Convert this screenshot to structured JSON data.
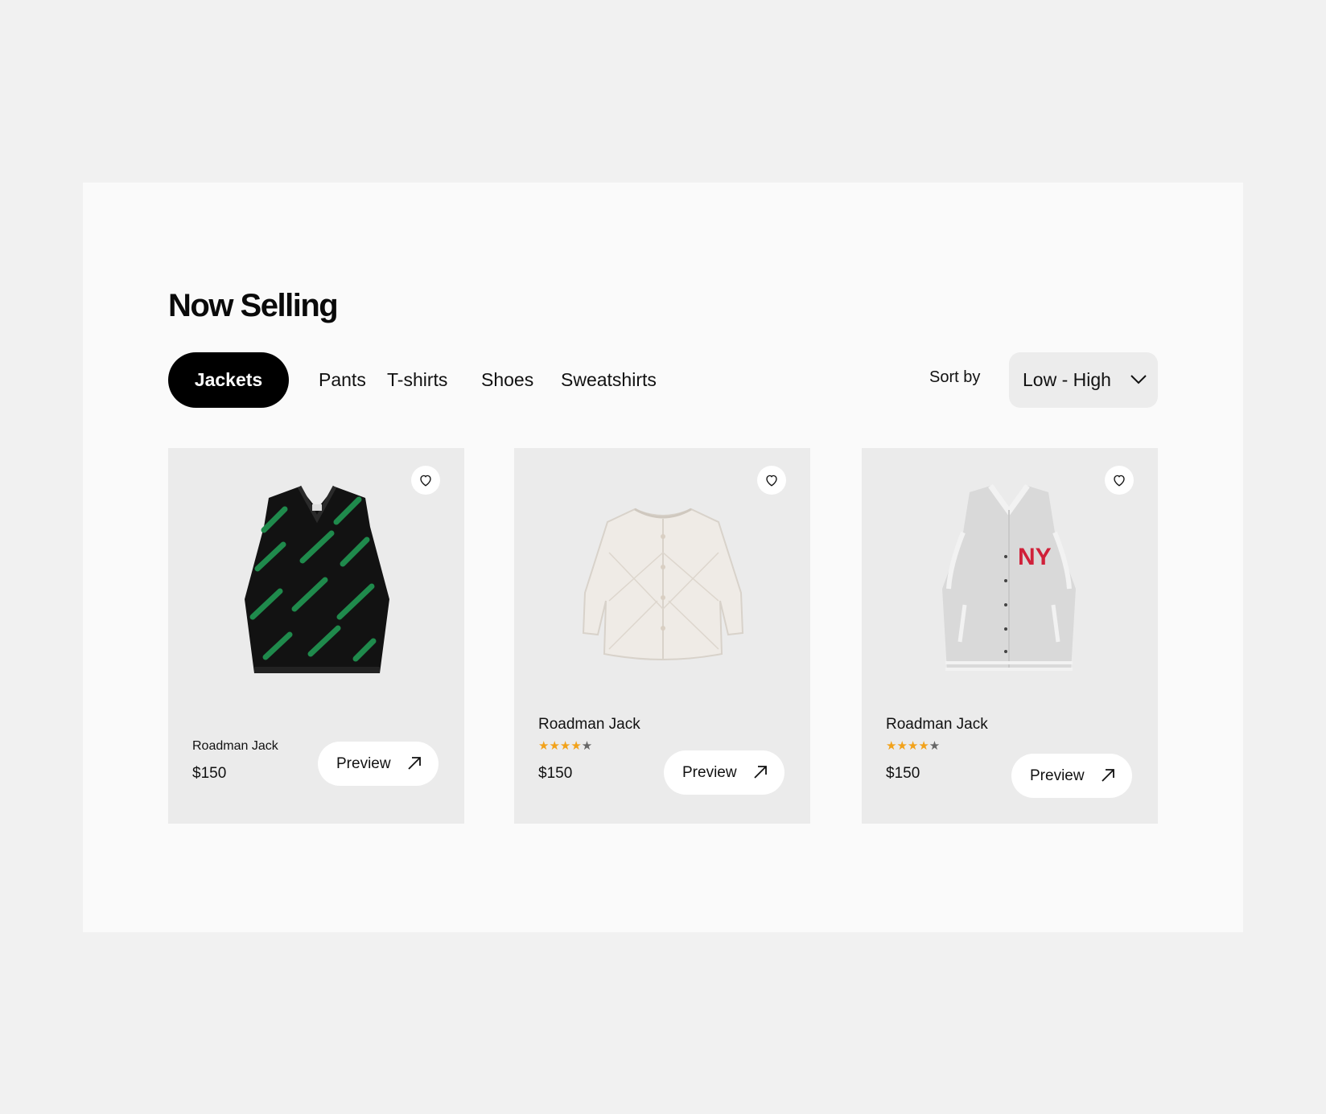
{
  "section": {
    "title": "Now Selling"
  },
  "tabs": [
    {
      "label": "Jackets",
      "active": true
    },
    {
      "label": "Pants",
      "active": false
    },
    {
      "label": "T-shirts",
      "active": false
    },
    {
      "label": "Shoes",
      "active": false
    },
    {
      "label": "Sweatshirts",
      "active": false
    }
  ],
  "sort": {
    "label": "Sort by",
    "value": "Low - High",
    "icon": "chevron-down-icon"
  },
  "products": [
    {
      "name": "Roadman Jack",
      "price": "$150",
      "rating": null,
      "preview_label": "Preview",
      "favorite_icon": "heart-icon",
      "image": "black-green-knit-vest"
    },
    {
      "name": "Roadman Jack",
      "price": "$150",
      "rating": 4,
      "preview_label": "Preview",
      "favorite_icon": "heart-icon",
      "image": "cream-quilted-jacket"
    },
    {
      "name": "Roadman Jack",
      "price": "$150",
      "rating": 4,
      "preview_label": "Preview",
      "favorite_icon": "heart-icon",
      "image": "grey-ny-varsity-vest"
    }
  ],
  "colors": {
    "page_bg": "#f1f1f1",
    "panel_bg": "#fafafa",
    "card_bg": "#ebebeb",
    "active_tab_bg": "#000000",
    "star_filled": "#f2a21a",
    "star_empty": "#666666"
  }
}
